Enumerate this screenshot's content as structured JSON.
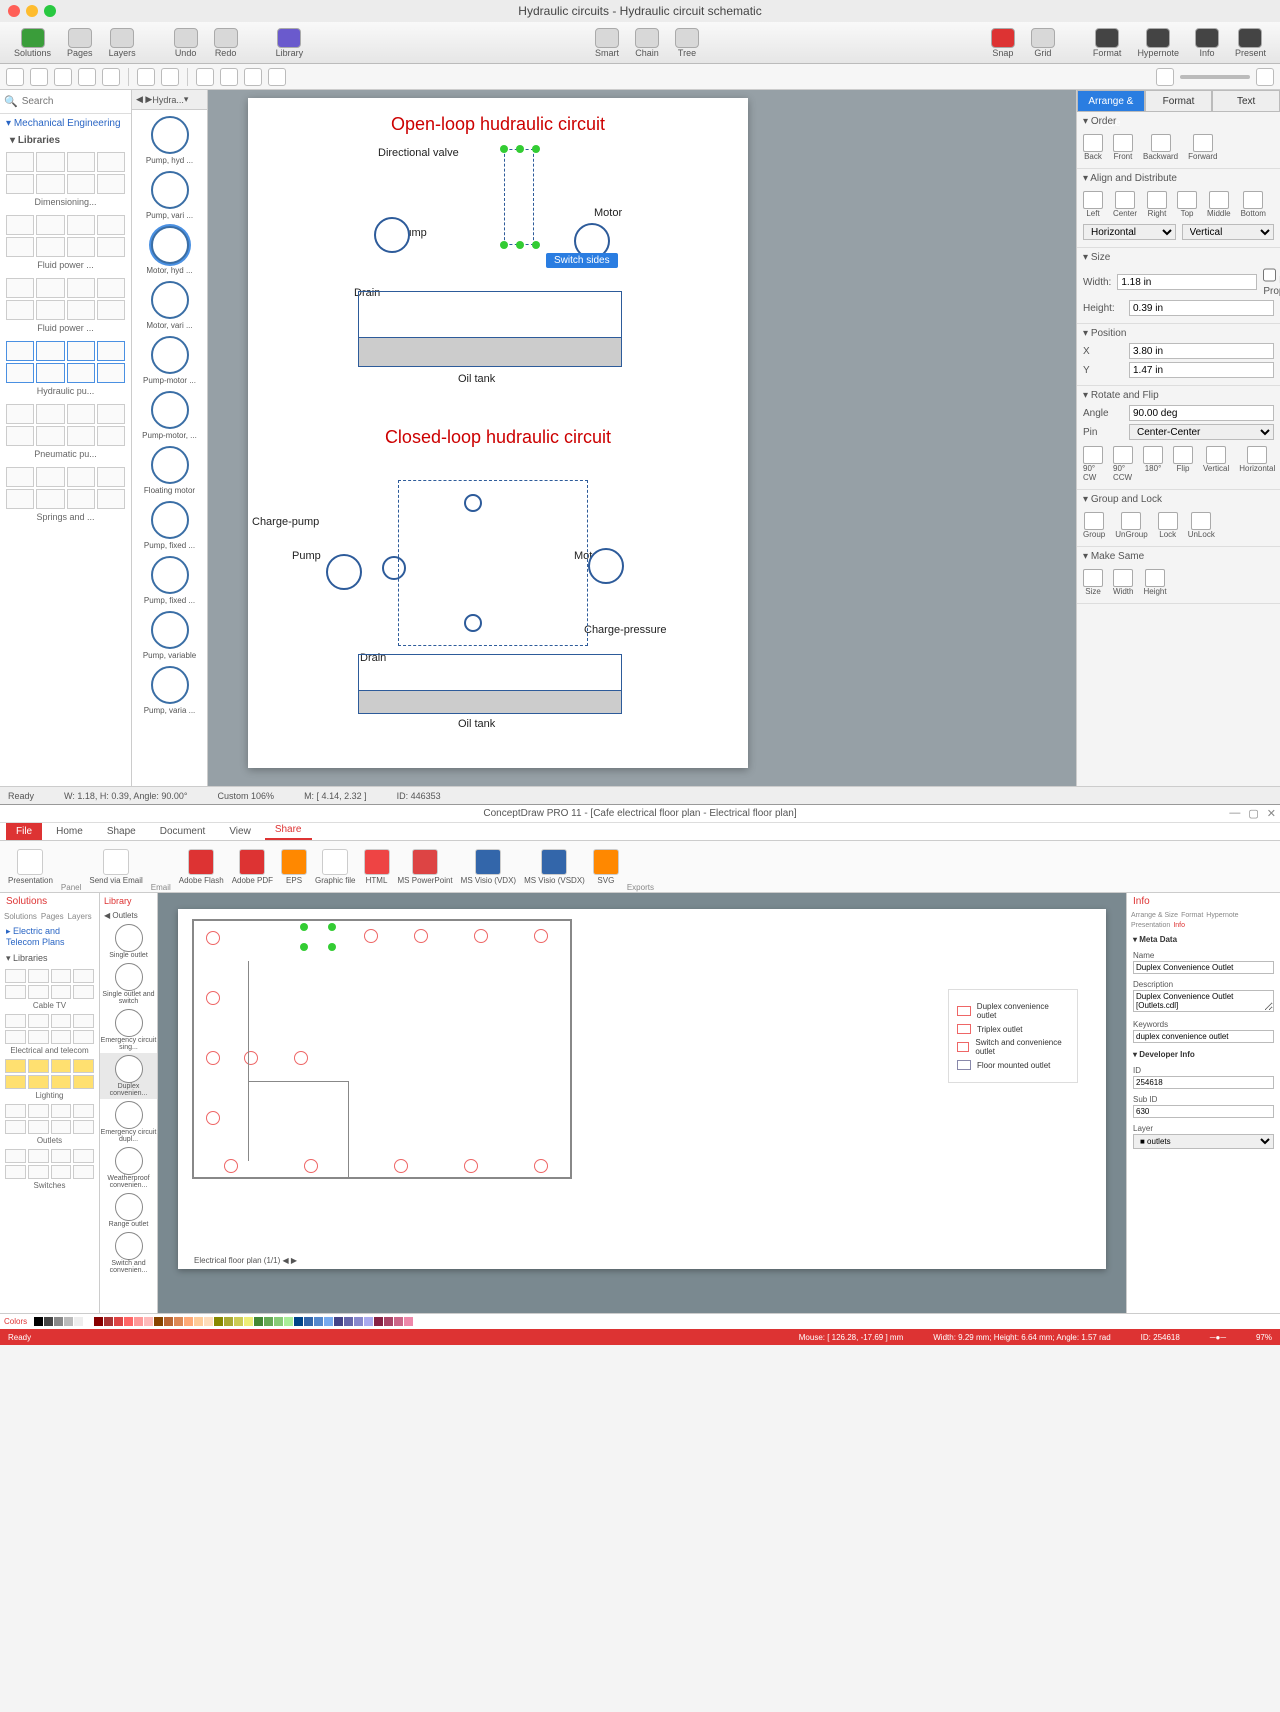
{
  "mac": {
    "window_title": "Hydraulic circuits - Hydraulic circuit schematic",
    "toolbar": {
      "solutions": "Solutions",
      "pages": "Pages",
      "layers": "Layers",
      "undo": "Undo",
      "redo": "Redo",
      "library": "Library",
      "smart": "Smart",
      "chain": "Chain",
      "tree": "Tree",
      "snap": "Snap",
      "grid": "Grid",
      "format": "Format",
      "hypernote": "Hypernote",
      "info": "Info",
      "present": "Present"
    },
    "search_placeholder": "Search",
    "solutions_panel": {
      "header": "Mechanical Engineering",
      "libs_label": "Libraries",
      "groups": [
        "Dimensioning...",
        "Fluid power ...",
        "Fluid power ...",
        "Hydraulic pu...",
        "Pneumatic pu...",
        "Springs and ..."
      ]
    },
    "shapes_crumb": "Hydra...",
    "shapes": [
      "Pump, hyd ...",
      "Pump, vari ...",
      "Motor, hyd ...",
      "Motor, vari ...",
      "Pump-motor ...",
      "Pump-motor, ...",
      "Floating motor",
      "Pump, fixed ...",
      "Pump, fixed ...",
      "Pump, variable",
      "Pump, varia ..."
    ],
    "canvas": {
      "title1": "Open-loop hudraulic circuit",
      "title2": "Closed-loop hudraulic circuit",
      "labels": {
        "dir_valve": "Directional valve",
        "pump": "Pump",
        "drain": "Drain",
        "oil_tank": "Oil tank",
        "motor": "Motor",
        "switch_tip": "Switch sides",
        "charge_pump": "Charge-pump",
        "charge_pressure": "Charge-pressure"
      }
    },
    "right": {
      "tabs": {
        "arrange": "Arrange & Size",
        "format": "Format",
        "text": "Text"
      },
      "order": {
        "title": "Order",
        "back": "Back",
        "front": "Front",
        "backward": "Backward",
        "forward": "Forward"
      },
      "align": {
        "title": "Align and Distribute",
        "left": "Left",
        "center": "Center",
        "right": "Right",
        "top": "Top",
        "middle": "Middle",
        "bottom": "Bottom",
        "horiz": "Horizontal",
        "vert": "Vertical"
      },
      "size": {
        "title": "Size",
        "width_label": "Width:",
        "height_label": "Height:",
        "width": "1.18 in",
        "height": "0.39 in",
        "lock": "Lock Proportions"
      },
      "position": {
        "title": "Position",
        "x_label": "X",
        "y_label": "Y",
        "x": "3.80 in",
        "y": "1.47 in"
      },
      "rotate": {
        "title": "Rotate and Flip",
        "angle_label": "Angle",
        "angle": "90.00 deg",
        "pin_label": "Pin",
        "pin": "Center-Center",
        "cw": "90° CW",
        "ccw": "90° CCW",
        "r180": "180°",
        "flip": "Flip",
        "vert": "Vertical",
        "horiz": "Horizontal"
      },
      "group": {
        "title": "Group and Lock",
        "group": "Group",
        "ungroup": "UnGroup",
        "lock": "Lock",
        "unlock": "UnLock"
      },
      "same": {
        "title": "Make Same",
        "size": "Size",
        "width": "Width",
        "height": "Height"
      }
    },
    "status": {
      "ready": "Ready",
      "custom": "Custom 106%",
      "wh": "W: 1.18,  H: 0.39,  Angle: 90.00°",
      "mouse": "M: [ 4.14, 2.32 ]",
      "id": "ID: 446353"
    }
  },
  "win": {
    "title": "ConceptDraw PRO 11 - [Cafe electrical floor plan - Electrical floor plan]",
    "tabs": {
      "file": "File",
      "home": "Home",
      "shape": "Shape",
      "document": "Document",
      "view": "View",
      "share": "Share"
    },
    "ribbon": {
      "presentation": "Presentation",
      "sendemail": "Send via Email",
      "flash": "Adobe Flash",
      "pdf": "Adobe PDF",
      "eps": "EPS",
      "gfile": "Graphic file",
      "html": "HTML",
      "ppt": "MS PowerPoint",
      "vdx": "MS Visio (VDX)",
      "vsdx": "MS Visio (VSDX)",
      "svg": "SVG",
      "group_panel": "Panel",
      "group_email": "Email",
      "group_exports": "Exports"
    },
    "solutions": {
      "head": "Solutions",
      "tabs": [
        "Solutions",
        "Pages",
        "Layers"
      ],
      "plan": "Electric and Telecom Plans",
      "libs": "Libraries",
      "groups": [
        "Cable TV",
        "Electrical and telecom",
        "Lighting",
        "Outlets",
        "Switches"
      ]
    },
    "shapes": {
      "head": "Library",
      "crumb": "Outlets",
      "items": [
        "Single outlet",
        "Single outlet and switch",
        "Emergency circuit sing...",
        "Duplex convenien...",
        "Emergency circuit dupl...",
        "Weatherproof convenien...",
        "Range outlet",
        "Switch and convenien..."
      ]
    },
    "legend": {
      "duplex": "Duplex convenience outlet",
      "triplex": "Triplex outlet",
      "switch": "Switch and convenience outlet",
      "floor": "Floor mounted outlet"
    },
    "info": {
      "head": "Info",
      "tabs": [
        "Arrange & Size",
        "Format",
        "Hypernote",
        "Presentation",
        "Info"
      ],
      "meta": "Meta Data",
      "name_label": "Name",
      "name": "Duplex Convenience Outlet",
      "desc_label": "Description",
      "desc": "Duplex Convenience Outlet [Outlets.cdl]",
      "keys_label": "Keywords",
      "keys": "duplex convenience outlet",
      "dev": "Developer Info",
      "id_label": "ID",
      "id": "254618",
      "subid_label": "Sub ID",
      "subid": "630",
      "layer_label": "Layer",
      "layer": "outlets"
    },
    "page_tab": "Electrical floor plan (1/1)",
    "colors_label": "Colors",
    "status": {
      "ready": "Ready",
      "mouse": "Mouse: [ 126.28, -17.69 ] mm",
      "dims": "Width: 9.29 mm;  Height: 6.64 mm;  Angle: 1.57 rad",
      "id": "ID: 254618",
      "zoom": "97%"
    }
  }
}
